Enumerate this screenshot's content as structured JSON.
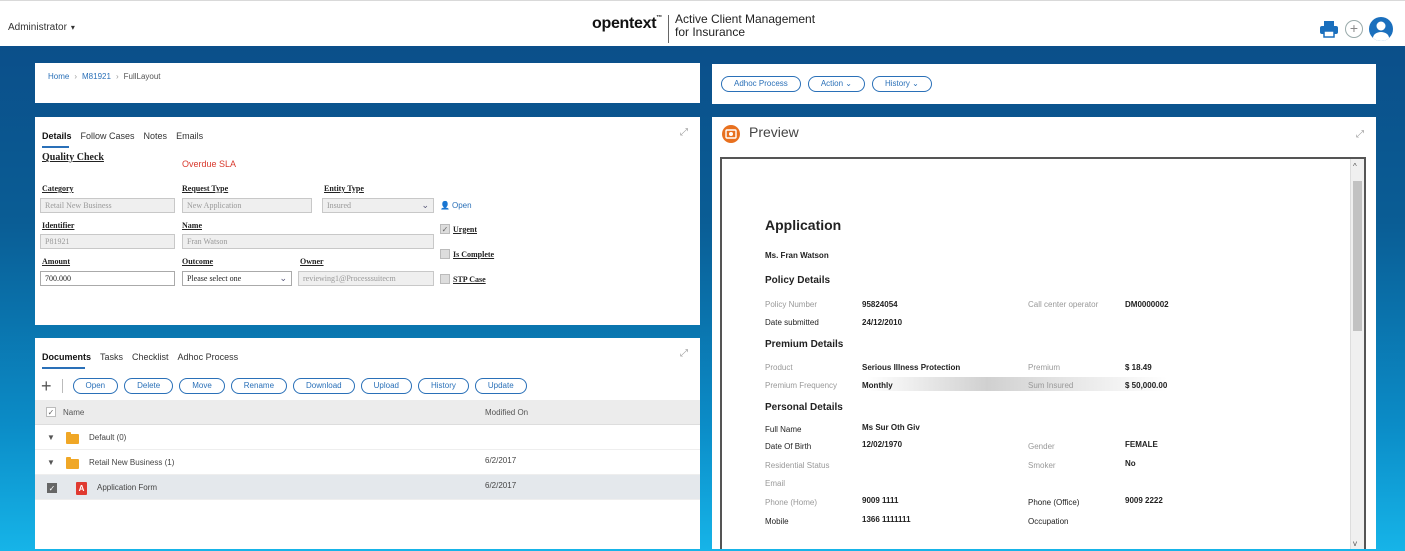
{
  "header": {
    "user": "Administrator",
    "brand_logo": "opentext",
    "brand_line1": "Active Client Management",
    "brand_line2": "for Insurance",
    "icons": [
      "printer-icon",
      "add-icon",
      "user-avatar-icon"
    ]
  },
  "breadcrumb": {
    "home": "Home",
    "case": "M81921",
    "layout": "FullLayout"
  },
  "actions": {
    "adhoc": "Adhoc Process",
    "action": "Action",
    "history": "History"
  },
  "details": {
    "tabs": [
      "Details",
      "Follow Cases",
      "Notes",
      "Emails"
    ],
    "task_title": "Quality Check",
    "sla": "Overdue SLA",
    "category_label": "Category",
    "category_value": "Retail New Business",
    "request_type_label": "Request Type",
    "request_type_value": "New Application",
    "entity_type_label": "Entity Type",
    "entity_type_value": "Insured",
    "open_link": "Open",
    "identifier_label": "Identifier",
    "identifier_value": "P81921",
    "name_label": "Name",
    "name_value": "Fran Watson",
    "urgent_label": "Urgent",
    "is_complete_label": "Is Complete",
    "amount_label": "Amount",
    "amount_value": "700.000",
    "outcome_label": "Outcome",
    "outcome_value": "Please select one",
    "owner_label": "Owner",
    "owner_value": "reviewing1@Processsuitecm",
    "stp_label": "STP Case"
  },
  "documents": {
    "tabs": [
      "Documents",
      "Tasks",
      "Checklist",
      "Adhoc Process"
    ],
    "buttons": [
      "Open",
      "Delete",
      "Move",
      "Rename",
      "Download",
      "Upload",
      "History",
      "Update"
    ],
    "col_name": "Name",
    "col_modified": "Modified On",
    "rows": [
      {
        "name": "Default (0)",
        "modified": ""
      },
      {
        "name": "Retail New Business (1)",
        "modified": "6/2/2017"
      },
      {
        "name": "Application Form",
        "modified": "6/2/2017"
      }
    ]
  },
  "preview": {
    "title": "Preview",
    "doc": {
      "heading": "Application",
      "applicant": "Ms. Fran Watson",
      "policy_section": "Policy Details",
      "policy_number_label": "Policy Number",
      "policy_number": "95824054",
      "call_center_label": "Call center operator",
      "call_center": "DM0000002",
      "date_submitted_label": "Date submitted",
      "date_submitted": "24/12/2010",
      "premium_section": "Premium Details",
      "product_label": "Product",
      "product": "Serious Illness Protection",
      "premium_label": "Premium",
      "premium": "$ 18.49",
      "premium_freq_label": "Premium Frequency",
      "premium_freq": "Monthly",
      "sum_insured_label": "Sum Insured",
      "sum_insured": "$ 50,000.00",
      "personal_section": "Personal Details",
      "full_name_label": "Full Name",
      "full_name": "Ms Sur Oth Giv",
      "dob_label": "Date Of Birth",
      "dob": "12/02/1970",
      "gender_label": "Gender",
      "gender": "FEMALE",
      "residential_label": "Residential Status",
      "smoker_label": "Smoker",
      "smoker": "No",
      "email_label": "Email",
      "phone_home_label": "Phone (Home)",
      "phone_home": "9009 1111",
      "phone_office_label": "Phone (Office)",
      "phone_office": "9009 2222",
      "mobile_label": "Mobile",
      "mobile": "1366 1111111",
      "occupation_label": "Occupation"
    }
  }
}
